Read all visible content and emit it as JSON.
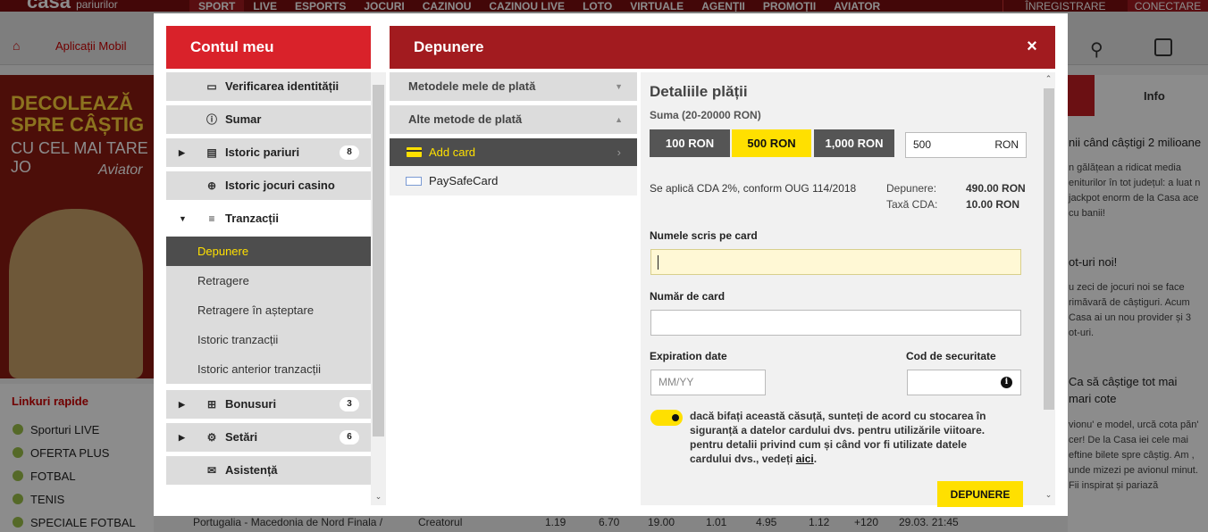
{
  "site": {
    "logo_main": "casa",
    "logo_sub": "pariurilor",
    "nav": [
      "SPORT",
      "LIVE",
      "ESPORTS",
      "JOCURI",
      "CAZINOU",
      "CAZINOU LIVE",
      "LOTO",
      "VIRTUALE",
      "AGENȚII",
      "PROMOȚII",
      "AVIATOR"
    ],
    "register": "ÎNREGISTRARE",
    "login": "CONECTARE",
    "subnav_app": "Aplicații Mobil",
    "banner_line1": "DECOLEAZĂ SPRE CÂȘTIG",
    "banner_line2": "CU CEL MAI TARE JO",
    "banner_aviator": "Aviator",
    "quicklinks_title": "Linkuri rapide",
    "quicklinks": [
      "Sporturi LIVE",
      "OFERTA PLUS",
      "FOTBAL",
      "TENIS",
      "SPECIALE FOTBAL"
    ],
    "right_tab": "Info",
    "right_text1_head": "nii când câștigi 2 milioane",
    "right_text1": "n gălățean a ridicat media eniturilor în tot județul: a luat n jackpot enorm de la Casa ace cu banii!",
    "right_text2_head": "ot-uri noi!",
    "right_text2": "u zeci de jocuri noi se face rimăvară de câștiguri. Acum Casa ai un nou provider și 3 ot-uri.",
    "right_text3_head": "Ca să câștige tot mai mari cote",
    "right_text3": "vionu' e model, urcă cota păn' cer! De la Casa iei cele mai eftine bilete spre câștig. Am , unde mizezi pe avionul minut. Fii inspirat și pariază",
    "bottom_row": [
      "Portugalia - Macedonia de Nord Finala /",
      "Creatorul",
      "1.19",
      "6.70",
      "19.00",
      "1.01",
      "4.95",
      "1.12",
      "+120",
      "29.03. 21:45"
    ]
  },
  "account": {
    "title": "Contul meu",
    "menu": [
      {
        "label": "Verificarea identității",
        "icon": "id-card-icon"
      },
      {
        "label": "Sumar",
        "icon": "info-icon"
      },
      {
        "label": "Istoric pariuri",
        "icon": "ticket-icon",
        "badge": "8"
      },
      {
        "label": "Istoric jocuri casino",
        "icon": "globe-icon"
      },
      {
        "label": "Tranzacții",
        "icon": "coins-icon"
      },
      {
        "label": "Bonusuri",
        "icon": "gift-icon",
        "badge": "3"
      },
      {
        "label": "Setări",
        "icon": "gears-icon",
        "badge": "6"
      },
      {
        "label": "Asistență",
        "icon": "mail-icon"
      }
    ],
    "submenu": [
      "Depunere",
      "Retragere",
      "Retragere în așteptare",
      "Istoric tranzacții",
      "Istoric anterior tranzacții"
    ]
  },
  "deposit": {
    "title": "Depunere",
    "close": "×",
    "my_methods": "Metodele mele de plată",
    "other_methods": "Alte metode de plată",
    "add_card": "Add card",
    "paysafecard": "PaySafeCard",
    "details_title": "Detaliile plății",
    "range": "Suma (20-20000 RON)",
    "amounts": [
      "100 RON",
      "500 RON",
      "1,000 RON"
    ],
    "selected_amount": "500 RON",
    "amount_value": "500",
    "currency": "RON",
    "cda_note": "Se aplică CDA 2%, conform OUG 114/2018",
    "deposit_label": "Depunere:",
    "deposit_value": "490.00 RON",
    "tax_label": "Taxă CDA:",
    "tax_value": "10.00 RON",
    "name_label": "Numele scris pe card",
    "card_label": "Număr de card",
    "exp_label": "Expiration date",
    "exp_placeholder": "MM/YY",
    "cvv_label": "Cod de securitate",
    "consent_text": "dacă bifați această căsuță, sunteți de acord cu stocarea în siguranță a datelor cardului dvs. pentru utilizările viitoare. pentru detalii privind cum și când vor fi utilizate datele cardului dvs., vedeți ",
    "consent_link": "aici",
    "consent_end": ".",
    "submit": "DEPUNERE"
  },
  "colors": {
    "accent_red": "#d9222a",
    "dark_red": "#a21b1f",
    "yellow": "#ffe000",
    "active_gray": "#4d4d4d"
  }
}
